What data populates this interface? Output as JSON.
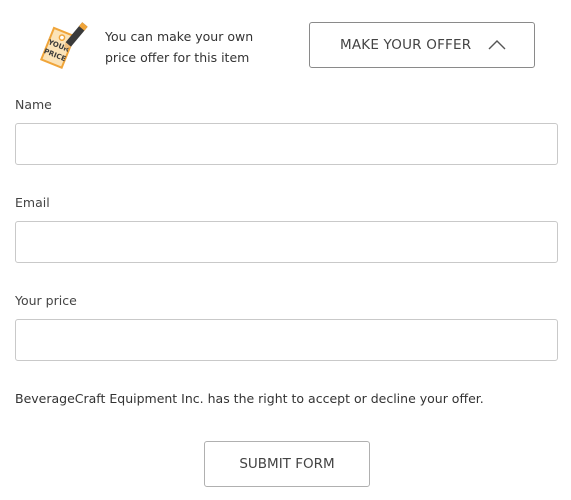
{
  "offer_banner": {
    "icon": "price-tag-pencil-icon",
    "intro_line1": "You can make your own",
    "intro_line2": "price offer for this item",
    "toggle_label": "MAKE YOUR OFFER",
    "toggle_icon": "chevron-up-icon"
  },
  "form": {
    "fields": [
      {
        "label": "Name",
        "value": "",
        "placeholder": ""
      },
      {
        "label": "Email",
        "value": "",
        "placeholder": ""
      },
      {
        "label": "Your price",
        "value": "",
        "placeholder": ""
      }
    ],
    "disclaimer": "BeverageCraft Equipment Inc. has the right to accept or decline your offer.",
    "submit_label": "SUBMIT FORM"
  },
  "colors": {
    "icon_orange": "#f0a53a",
    "icon_dark": "#3a3a3a",
    "border": "#c9c9c9",
    "text": "#333333"
  }
}
